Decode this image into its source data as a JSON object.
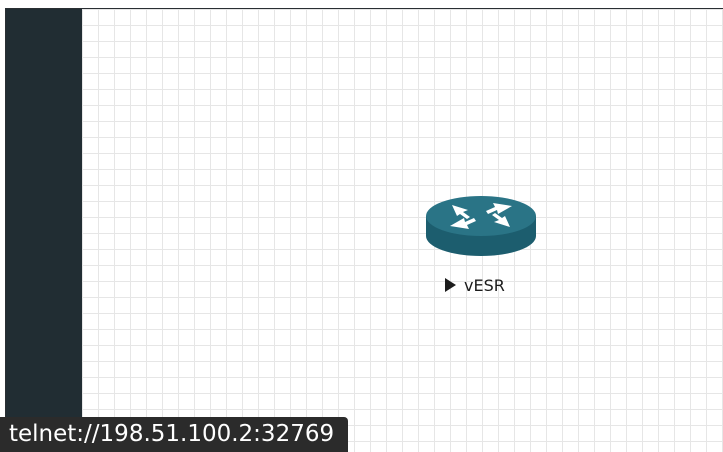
{
  "node": {
    "label": "vESR",
    "icon": "router-icon",
    "status_icon": "play-icon"
  },
  "statusbar": {
    "link_url": "telnet://198.51.100.2:32769"
  },
  "colors": {
    "sidebar": "#212d33",
    "router_top": "#2a7486",
    "router_body": "#1c5d6e",
    "grid": "#e6e6e6"
  }
}
